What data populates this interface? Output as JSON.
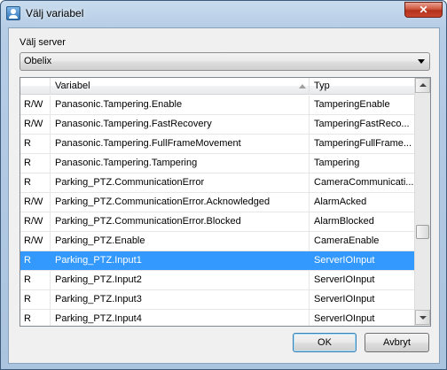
{
  "window": {
    "title": "Välj variabel",
    "close_label": "✕"
  },
  "server": {
    "label": "Välj server",
    "selected": "Obelix"
  },
  "grid": {
    "columns": {
      "access": "",
      "variable": "Variabel",
      "type": "Typ"
    },
    "rows": [
      {
        "access": "R/W",
        "variable": "Panasonic.Tampering.Enable",
        "type": "TamperingEnable"
      },
      {
        "access": "R/W",
        "variable": "Panasonic.Tampering.FastRecovery",
        "type": "TamperingFastReco..."
      },
      {
        "access": "R",
        "variable": "Panasonic.Tampering.FullFrameMovement",
        "type": "TamperingFullFrame..."
      },
      {
        "access": "R",
        "variable": "Panasonic.Tampering.Tampering",
        "type": "Tampering"
      },
      {
        "access": "R",
        "variable": "Parking_PTZ.CommunicationError",
        "type": "CameraCommunicati..."
      },
      {
        "access": "R/W",
        "variable": "Parking_PTZ.CommunicationError.Acknowledged",
        "type": "AlarmAcked"
      },
      {
        "access": "R/W",
        "variable": "Parking_PTZ.CommunicationError.Blocked",
        "type": "AlarmBlocked"
      },
      {
        "access": "R/W",
        "variable": "Parking_PTZ.Enable",
        "type": "CameraEnable"
      },
      {
        "access": "R",
        "variable": "Parking_PTZ.Input1",
        "type": "ServerIOInput"
      },
      {
        "access": "R",
        "variable": "Parking_PTZ.Input2",
        "type": "ServerIOInput"
      },
      {
        "access": "R",
        "variable": "Parking_PTZ.Input3",
        "type": "ServerIOInput"
      },
      {
        "access": "R",
        "variable": "Parking_PTZ.Input4",
        "type": "ServerIOInput"
      }
    ],
    "selected_row": 8
  },
  "buttons": {
    "ok": "OK",
    "cancel": "Avbryt"
  },
  "colors": {
    "selection": "#3399ff",
    "title_gradient": "#b6cde6",
    "close_button": "#c9462b"
  }
}
